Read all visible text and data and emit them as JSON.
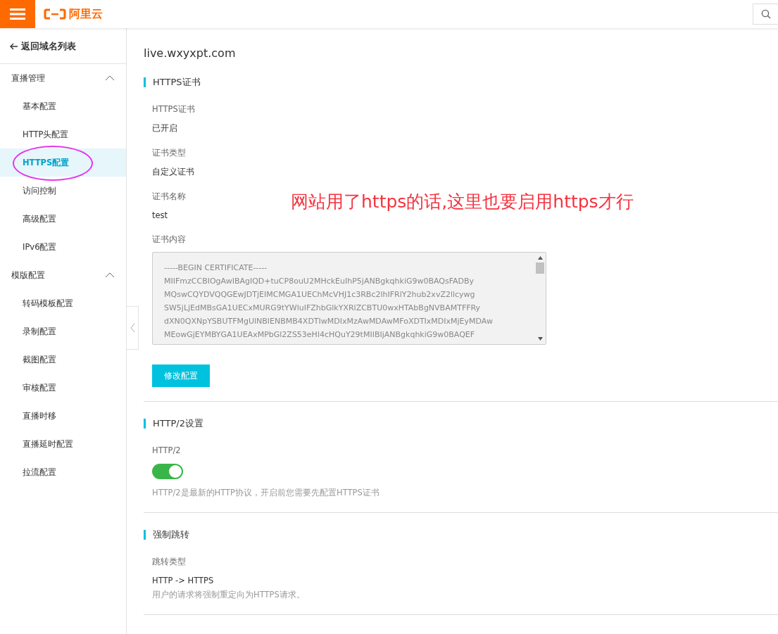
{
  "header": {
    "logo_text": "阿里云"
  },
  "sidebar": {
    "back_link": "返回域名列表",
    "groups": [
      {
        "title": "直播管理",
        "expanded": true,
        "items": [
          {
            "label": "基本配置",
            "selected": false
          },
          {
            "label": "HTTP头配置",
            "selected": false
          },
          {
            "label": "HTTPS配置",
            "selected": true
          },
          {
            "label": "访问控制",
            "selected": false
          },
          {
            "label": "高级配置",
            "selected": false
          },
          {
            "label": "IPv6配置",
            "selected": false
          }
        ]
      },
      {
        "title": "模版配置",
        "expanded": true,
        "items": [
          {
            "label": "转码模板配置",
            "selected": false
          },
          {
            "label": "录制配置",
            "selected": false
          },
          {
            "label": "截图配置",
            "selected": false
          },
          {
            "label": "审核配置",
            "selected": false
          },
          {
            "label": "直播时移",
            "selected": false
          },
          {
            "label": "直播延时配置",
            "selected": false
          },
          {
            "label": "拉流配置",
            "selected": false
          }
        ]
      }
    ]
  },
  "domain": "live.wxyxpt.com",
  "annotation": "网站用了https的话,这里也要启用https才行",
  "sections": [
    {
      "title": "HTTPS证书",
      "fields": [
        {
          "kind": "text",
          "label": "HTTPS证书",
          "value": "已开启"
        },
        {
          "kind": "text",
          "label": "证书类型",
          "value": "自定义证书"
        },
        {
          "kind": "text",
          "label": "证书名称",
          "value": "test"
        },
        {
          "kind": "cert",
          "label": "证书内容",
          "lines": [
            "-----BEGIN CERTIFICATE-----",
            "MIIFmzCCBIOgAwIBAgIQD+tuCP8ouU2MHckEuIhP5jANBgkqhkiG9w0BAQsFADBy",
            "MQswCQYDVQQGEwJDTjEIMCMGA1UEChMcVHJ1c3RBc2lhIFRlY2hub2xvZ2llcywg",
            "SW5jLjEdMBsGA1UECxMURG9tYWluIFZhbGlkYXRlZCBTU0wxHTAbBgNVBAMTFFRy",
            "dXN0QXNpYSBUTFMgUlNBIENBMB4XDTIwMDIxMzAwMDAwMFoXDTIxMDIxMjEyMDAw",
            "MEowGjEYMBYGA1UEAxMPbGl2ZS53eHl4cHQuY29tMIIBIjANBgkqhkiG9w0BAQEF"
          ]
        },
        {
          "kind": "button",
          "label": "修改配置"
        }
      ]
    },
    {
      "title": "HTTP/2设置",
      "fields": [
        {
          "kind": "switch",
          "label": "HTTP/2",
          "on": true,
          "hint": "HTTP/2是最新的HTTP协议，开启前您需要先配置HTTPS证书"
        }
      ]
    },
    {
      "title": "强制跳转",
      "fields": [
        {
          "kind": "text",
          "label": "跳转类型",
          "value": "HTTP -> HTTPS",
          "hint": "用户的请求将强制重定向为HTTPS请求。"
        }
      ]
    }
  ]
}
